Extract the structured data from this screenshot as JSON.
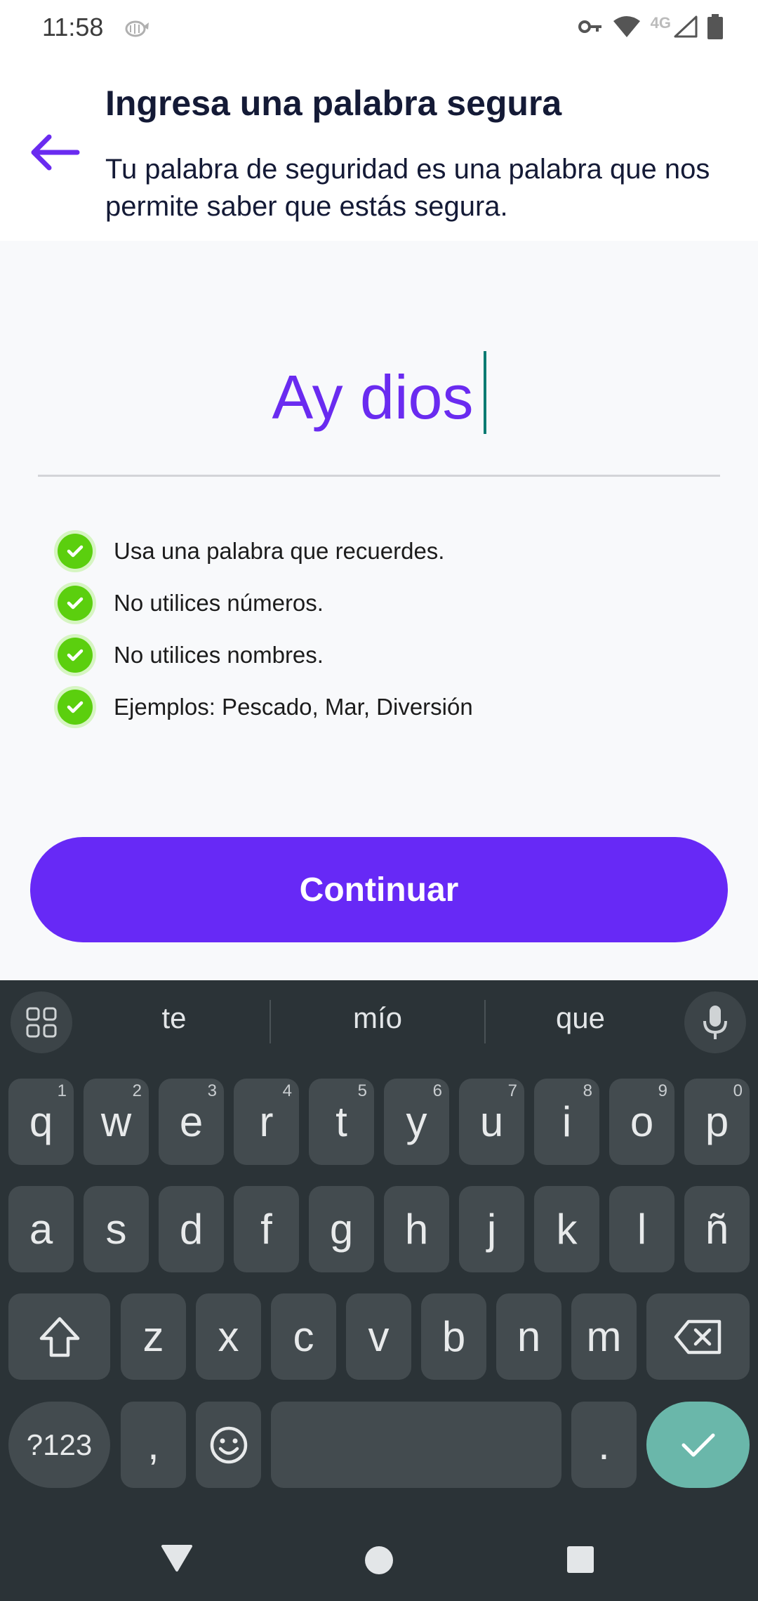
{
  "status_bar": {
    "time": "11:58",
    "network": "4G"
  },
  "header": {
    "title": "Ingresa una palabra segura",
    "subtitle": "Tu palabra de seguridad es una palabra que nos permite saber que estás segura."
  },
  "word_input": {
    "value": "Ay dios"
  },
  "rules": [
    {
      "text": "Usa una palabra que recuerdes."
    },
    {
      "text": "No utilices números."
    },
    {
      "text": "No utilices nombres."
    },
    {
      "text": "Ejemplos: Pescado, Mar, Diversión"
    }
  ],
  "continue_label": "Continuar",
  "keyboard": {
    "suggestions": [
      "te",
      "mío",
      "que"
    ],
    "row1": [
      {
        "label": "q",
        "num": "1"
      },
      {
        "label": "w",
        "num": "2"
      },
      {
        "label": "e",
        "num": "3"
      },
      {
        "label": "r",
        "num": "4"
      },
      {
        "label": "t",
        "num": "5"
      },
      {
        "label": "y",
        "num": "6"
      },
      {
        "label": "u",
        "num": "7"
      },
      {
        "label": "i",
        "num": "8"
      },
      {
        "label": "o",
        "num": "9"
      },
      {
        "label": "p",
        "num": "0"
      }
    ],
    "row2": [
      "a",
      "s",
      "d",
      "f",
      "g",
      "h",
      "j",
      "k",
      "l",
      "ñ"
    ],
    "row3": [
      "z",
      "x",
      "c",
      "v",
      "b",
      "n",
      "m"
    ],
    "symbols_label": "?123",
    "comma": ",",
    "period": "."
  },
  "colors": {
    "accent": "#6729f6",
    "word": "#6a2bf0",
    "check": "#5bcf0e",
    "keyboard_bg": "#2b3337",
    "enter": "#6ab7aa"
  }
}
